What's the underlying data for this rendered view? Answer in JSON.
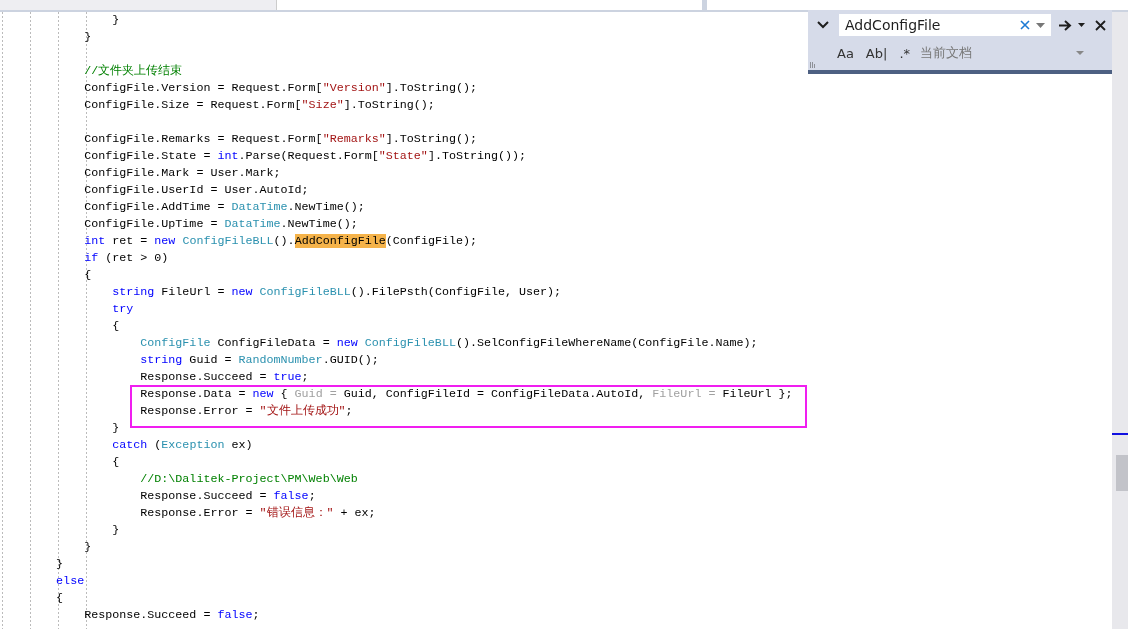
{
  "find_widget": {
    "search": {
      "value": "AddConfigFile"
    },
    "options": [
      {
        "label": "Aa"
      },
      {
        "label": "Ab|"
      },
      {
        "label": ".*"
      }
    ],
    "scope": "当前文档"
  },
  "editor": {
    "lines": [
      {
        "tokens": [
          {
            "text": "                }",
            "kind": "plain"
          }
        ]
      },
      {
        "tokens": [
          {
            "text": "            }",
            "kind": "plain"
          }
        ]
      },
      {
        "kind": "blank"
      },
      {
        "tokens": [
          {
            "text": "            //文件夹上传结束",
            "kind": "comment"
          }
        ]
      },
      {
        "tokens": [
          {
            "text": "            ConfigFile.Version = Request.Form[",
            "kind": "plain"
          },
          {
            "text": "\"Version\"",
            "kind": "string"
          },
          {
            "text": "].ToString();",
            "kind": "plain"
          }
        ]
      },
      {
        "tokens": [
          {
            "text": "            ConfigFile.Size = Request.Form[",
            "kind": "plain"
          },
          {
            "text": "\"Size\"",
            "kind": "string"
          },
          {
            "text": "].ToString();",
            "kind": "plain"
          }
        ]
      },
      {
        "kind": "blank"
      },
      {
        "tokens": [
          {
            "text": "            ConfigFile.Remarks = Request.Form[",
            "kind": "plain"
          },
          {
            "text": "\"Remarks\"",
            "kind": "string"
          },
          {
            "text": "].ToString();",
            "kind": "plain"
          }
        ]
      },
      {
        "tokens": [
          {
            "text": "            ConfigFile.State = ",
            "kind": "plain"
          },
          {
            "text": "int",
            "kind": "keyword"
          },
          {
            "text": ".Parse(Request.Form[",
            "kind": "plain"
          },
          {
            "text": "\"State\"",
            "kind": "string"
          },
          {
            "text": "].ToString());",
            "kind": "plain"
          }
        ]
      },
      {
        "tokens": [
          {
            "text": "            ConfigFile.Mark = User.Mark;",
            "kind": "plain"
          }
        ]
      },
      {
        "tokens": [
          {
            "text": "            ConfigFile.UserId = User.AutoId;",
            "kind": "plain"
          }
        ]
      },
      {
        "tokens": [
          {
            "text": "            ConfigFile.AddTime = ",
            "kind": "plain"
          },
          {
            "text": "DataTime",
            "kind": "type"
          },
          {
            "text": ".NewTime();",
            "kind": "plain"
          }
        ]
      },
      {
        "tokens": [
          {
            "text": "            ConfigFile.UpTime = ",
            "kind": "plain"
          },
          {
            "text": "DataTime",
            "kind": "type"
          },
          {
            "text": ".NewTime();",
            "kind": "plain"
          }
        ]
      },
      {
        "tokens": [
          {
            "text": "            int",
            "kind": "keyword"
          },
          {
            "text": " ret = ",
            "kind": "plain"
          },
          {
            "text": "new ",
            "kind": "keyword"
          },
          {
            "text": "ConfigFileBLL",
            "kind": "type"
          },
          {
            "text": "().",
            "kind": "plain"
          },
          {
            "text": "AddConfigFile",
            "kind": "match"
          },
          {
            "text": "(ConfigFile);",
            "kind": "plain"
          }
        ]
      },
      {
        "tokens": [
          {
            "text": "            if",
            "kind": "keyword"
          },
          {
            "text": " (ret > 0)",
            "kind": "plain"
          }
        ]
      },
      {
        "tokens": [
          {
            "text": "            {",
            "kind": "plain"
          }
        ]
      },
      {
        "tokens": [
          {
            "text": "                string",
            "kind": "keyword"
          },
          {
            "text": " FileUrl = ",
            "kind": "plain"
          },
          {
            "text": "new ",
            "kind": "keyword"
          },
          {
            "text": "ConfigFileBLL",
            "kind": "type"
          },
          {
            "text": "().FilePsth(ConfigFile, User);",
            "kind": "plain"
          }
        ]
      },
      {
        "tokens": [
          {
            "text": "                try",
            "kind": "keyword"
          }
        ]
      },
      {
        "tokens": [
          {
            "text": "                {",
            "kind": "plain"
          }
        ]
      },
      {
        "tokens": [
          {
            "text": "                    ConfigFile",
            "kind": "type"
          },
          {
            "text": " ConfigFileData = ",
            "kind": "plain"
          },
          {
            "text": "new ",
            "kind": "keyword"
          },
          {
            "text": "ConfigFileBLL",
            "kind": "type"
          },
          {
            "text": "().SelConfigFileWhereName(ConfigFile.Name);",
            "kind": "plain"
          }
        ]
      },
      {
        "tokens": [
          {
            "text": "                    string",
            "kind": "keyword"
          },
          {
            "text": " Guid = ",
            "kind": "plain"
          },
          {
            "text": "RandomNumber",
            "kind": "type"
          },
          {
            "text": ".GUID();",
            "kind": "plain"
          }
        ]
      },
      {
        "tokens": [
          {
            "text": "                    Response.Succeed = ",
            "kind": "plain"
          },
          {
            "text": "true",
            "kind": "keyword"
          },
          {
            "text": ";",
            "kind": "plain"
          }
        ]
      },
      {
        "boxed": true,
        "tokens": [
          {
            "text": "                    Response.Data = ",
            "kind": "plain"
          },
          {
            "text": "new",
            "kind": "keyword"
          },
          {
            "text": " { ",
            "kind": "plain"
          },
          {
            "text": "Guid = ",
            "kind": "faded"
          },
          {
            "text": "Guid, ConfigFileId = ConfigFileData.AutoId, ",
            "kind": "plain"
          },
          {
            "text": "FileUrl = ",
            "kind": "faded"
          },
          {
            "text": "FileUrl };",
            "kind": "plain"
          }
        ]
      },
      {
        "boxed": true,
        "tokens": [
          {
            "text": "                    Response.Error = ",
            "kind": "plain"
          },
          {
            "text": "\"文件上传成功\"",
            "kind": "string"
          },
          {
            "text": ";",
            "kind": "plain"
          }
        ]
      },
      {
        "tokens": [
          {
            "text": "                }",
            "kind": "plain"
          }
        ]
      },
      {
        "tokens": [
          {
            "text": "                catch",
            "kind": "keyword"
          },
          {
            "text": " (",
            "kind": "plain"
          },
          {
            "text": "Exception",
            "kind": "type"
          },
          {
            "text": " ex)",
            "kind": "plain"
          }
        ]
      },
      {
        "tokens": [
          {
            "text": "                {",
            "kind": "plain"
          }
        ]
      },
      {
        "tokens": [
          {
            "text": "                    //D:\\Dalitek-Project\\PM\\Web\\Web",
            "kind": "comment"
          }
        ]
      },
      {
        "tokens": [
          {
            "text": "                    Response.Succeed = ",
            "kind": "plain"
          },
          {
            "text": "false",
            "kind": "keyword"
          },
          {
            "text": ";",
            "kind": "plain"
          }
        ]
      },
      {
        "tokens": [
          {
            "text": "                    Response.Error = ",
            "kind": "plain"
          },
          {
            "text": "\"错误信息：\"",
            "kind": "string"
          },
          {
            "text": " + ex;",
            "kind": "plain"
          }
        ]
      },
      {
        "tokens": [
          {
            "text": "                }",
            "kind": "plain"
          }
        ]
      },
      {
        "tokens": [
          {
            "text": "            }",
            "kind": "plain"
          }
        ]
      },
      {
        "tokens": [
          {
            "text": "        }",
            "kind": "plain"
          }
        ]
      },
      {
        "tokens": [
          {
            "text": "        else",
            "kind": "keyword"
          }
        ]
      },
      {
        "tokens": [
          {
            "text": "        {",
            "kind": "plain"
          }
        ]
      },
      {
        "tokens": [
          {
            "text": "            Response.Succeed = ",
            "kind": "plain"
          },
          {
            "text": "false",
            "kind": "keyword"
          },
          {
            "text": ";",
            "kind": "plain"
          }
        ]
      }
    ]
  }
}
